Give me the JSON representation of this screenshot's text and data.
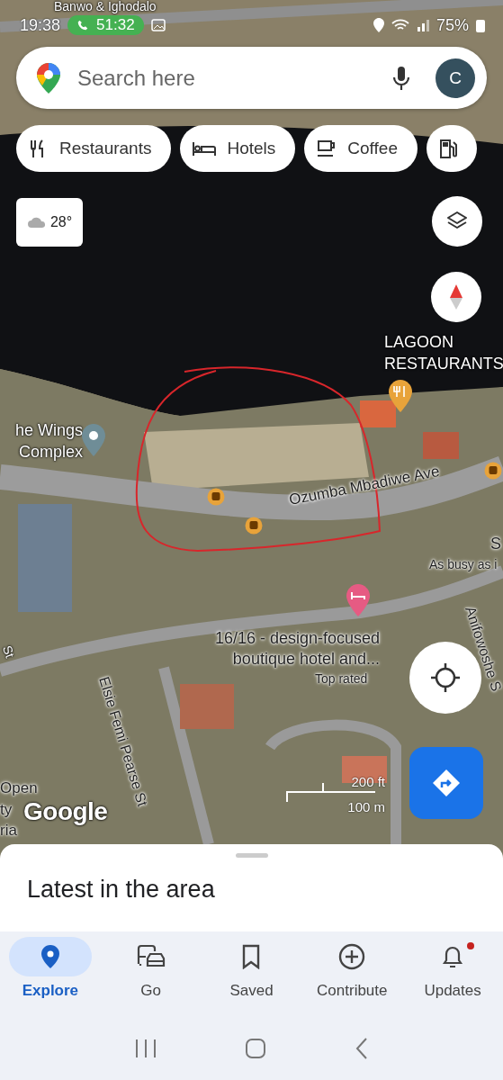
{
  "status_bar": {
    "time": "19:38",
    "call_duration": "51:32",
    "battery": "75%"
  },
  "search": {
    "placeholder": "Search here",
    "avatar_letter": "C"
  },
  "chips": [
    {
      "kind": "restaurant",
      "label": "Restaurants"
    },
    {
      "kind": "hotel",
      "label": "Hotels"
    },
    {
      "kind": "coffee",
      "label": "Coffee"
    },
    {
      "kind": "gas"
    }
  ],
  "weather": {
    "temperature": "28°"
  },
  "map_labels": [
    {
      "text": "Banwo & Ighodalo",
      "kind": "light"
    },
    {
      "text": "LAGOON RESTAURANTS",
      "kind": "light"
    },
    {
      "text": "he Wings Complex",
      "kind": "light"
    },
    {
      "text": "Ozumba Mbadiwe Ave",
      "kind": "dark"
    },
    {
      "text": "S",
      "kind": "dark"
    },
    {
      "text": "As busy as i",
      "kind": "dark"
    },
    {
      "text": "16/16 - design-focused boutique hotel and...",
      "kind": "dark"
    },
    {
      "text": "Top rated",
      "kind": "dark"
    },
    {
      "text": "St",
      "kind": "light"
    },
    {
      "text": "Elsie Femi Pearse St",
      "kind": "dark"
    },
    {
      "text": "Anifowoshe S",
      "kind": "dark"
    },
    {
      "text": "Open",
      "kind": "dark"
    },
    {
      "text": "ty",
      "kind": "dark"
    },
    {
      "text": "ria",
      "kind": "dark"
    }
  ],
  "scale": {
    "imperial": "200 ft",
    "metric": "100 m"
  },
  "logo": "Google",
  "sheet": {
    "title": "Latest in the area"
  },
  "nav": [
    {
      "kind": "explore",
      "label": "Explore",
      "selected": true,
      "badge": false
    },
    {
      "kind": "go",
      "label": "Go",
      "selected": false,
      "badge": false
    },
    {
      "kind": "saved",
      "label": "Saved",
      "selected": false,
      "badge": false
    },
    {
      "kind": "contribute",
      "label": "Contribute",
      "selected": false,
      "badge": false
    },
    {
      "kind": "updates",
      "label": "Updates",
      "selected": false,
      "badge": true
    }
  ]
}
